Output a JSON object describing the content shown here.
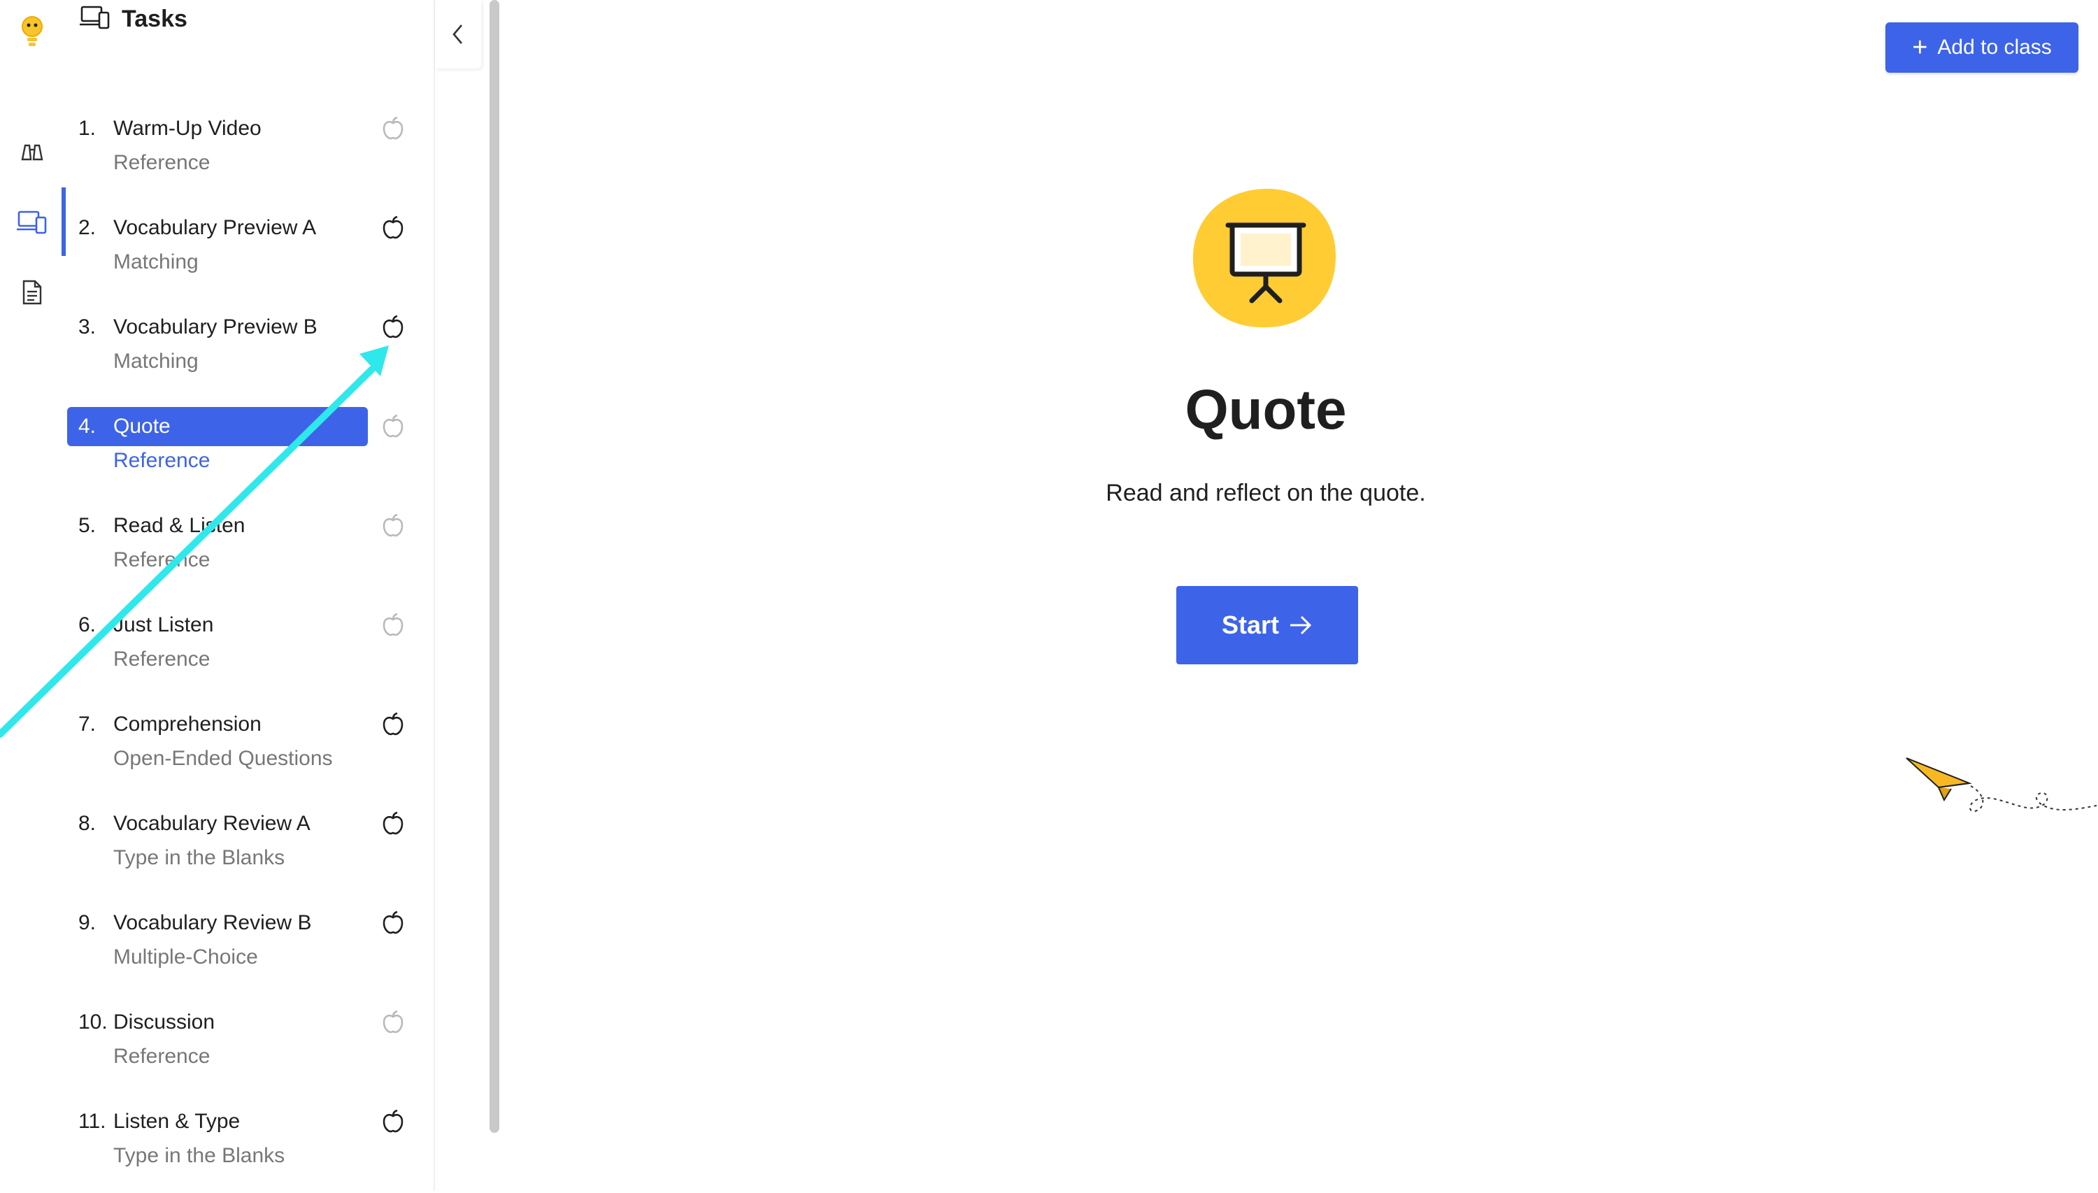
{
  "sidebar": {
    "title": "Tasks",
    "tasks": [
      {
        "number": "1.",
        "title": "Warm-Up Video",
        "subtitle": "Reference"
      },
      {
        "number": "2.",
        "title": "Vocabulary Preview A",
        "subtitle": "Matching"
      },
      {
        "number": "3.",
        "title": "Vocabulary Preview B",
        "subtitle": "Matching"
      },
      {
        "number": "4.",
        "title": "Quote",
        "subtitle": "Reference"
      },
      {
        "number": "5.",
        "title": "Read & Listen",
        "subtitle": "Reference"
      },
      {
        "number": "6.",
        "title": "Just Listen",
        "subtitle": "Reference"
      },
      {
        "number": "7.",
        "title": "Comprehension",
        "subtitle": "Open-Ended Questions"
      },
      {
        "number": "8.",
        "title": "Vocabulary Review A",
        "subtitle": "Type in the Blanks"
      },
      {
        "number": "9.",
        "title": "Vocabulary Review B",
        "subtitle": "Multiple-Choice"
      },
      {
        "number": "10.",
        "title": "Discussion",
        "subtitle": "Reference"
      },
      {
        "number": "11.",
        "title": "Listen & Type",
        "subtitle": "Type in the Blanks"
      }
    ]
  },
  "header": {
    "add_to_class_label": "Add to class"
  },
  "main": {
    "title": "Quote",
    "description": "Read and reflect on the quote.",
    "start_label": "Start"
  },
  "icons": {
    "logo": "lightbulb-logo-icon",
    "rail": [
      "binoculars-icon",
      "devices-icon",
      "document-icon"
    ],
    "tasks_header": "devices-icon",
    "task_status": "apple-icon",
    "collapse": "chevron-left-icon",
    "hero": "presentation-board-icon",
    "start_arrow": "arrow-right-icon",
    "decoration": "paper-plane-icon"
  },
  "colors": {
    "accent": "#3d63e8",
    "hero_circle": "#ffcc33",
    "annotation": "#2ee8ec",
    "plane": "#f7b824"
  }
}
